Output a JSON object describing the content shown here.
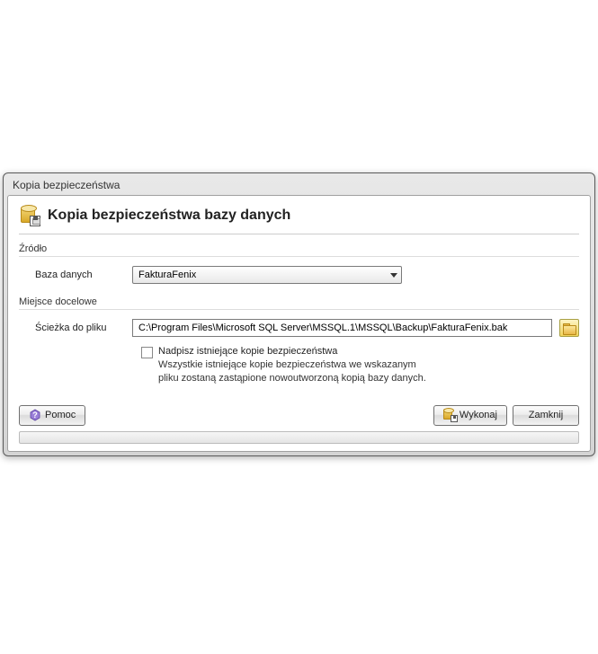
{
  "window": {
    "title": "Kopia bezpieczeństwa"
  },
  "header": {
    "title": "Kopia bezpieczeństwa bazy danych"
  },
  "source": {
    "group_title": "Źródło",
    "database_label": "Baza danych",
    "database_value": "FakturaFenix"
  },
  "destination": {
    "group_title": "Miejsce docelowe",
    "path_label": "Ścieżka do pliku",
    "path_value": "C:\\Program Files\\Microsoft SQL Server\\MSSQL.1\\MSSQL\\Backup\\FakturaFenix.bak",
    "overwrite_label": "Nadpisz istniejące kopie bezpieczeństwa",
    "overwrite_desc_line1": "Wszystkie istniejące kopie bezpieczeństwa we wskazanym",
    "overwrite_desc_line2": "pliku zostaną zastąpione nowoutworzoną kopią bazy danych.",
    "overwrite_checked": false
  },
  "buttons": {
    "help": "Pomoc",
    "execute": "Wykonaj",
    "close": "Zamknij"
  }
}
